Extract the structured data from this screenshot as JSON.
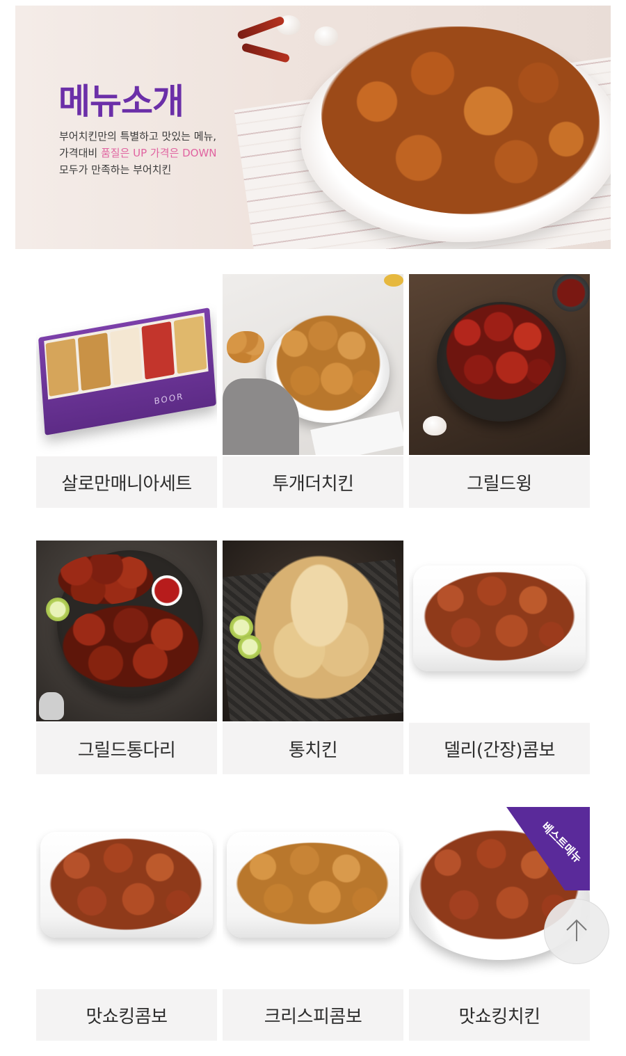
{
  "hero": {
    "title": "메뉴소개",
    "line1": "부어치킨만의 특별하고 맛있는 메뉴,",
    "line2_pre": "가격대비 ",
    "line2_highlight": "품질은 UP 가격은 DOWN",
    "line3": "모두가 만족하는 부어치킨"
  },
  "menu": [
    {
      "label": "살로만매니아세트",
      "image": "salomon-mania-set-box"
    },
    {
      "label": "투개더치킨",
      "image": "together-chicken"
    },
    {
      "label": "그릴드윙",
      "image": "grilled-wing"
    },
    {
      "label": "그릴드통다리",
      "image": "grilled-drumstick"
    },
    {
      "label": "통치킨",
      "image": "whole-chicken"
    },
    {
      "label": "델리(간장)콤보",
      "image": "deli-soy-combo"
    },
    {
      "label": "맛쇼킹콤보",
      "image": "matshoking-combo"
    },
    {
      "label": "크리스피콤보",
      "image": "crispy-combo"
    },
    {
      "label": "맛쇼킹치킨",
      "image": "matshoking-chicken"
    }
  ],
  "best_badge": "베스트메뉴",
  "box_logo": "BOOR",
  "scroll_top_icon": "arrow-up-icon",
  "colors": {
    "brand_purple": "#6b2fa8",
    "highlight_pink": "#e063a0",
    "label_bg": "#f4f3f3"
  }
}
